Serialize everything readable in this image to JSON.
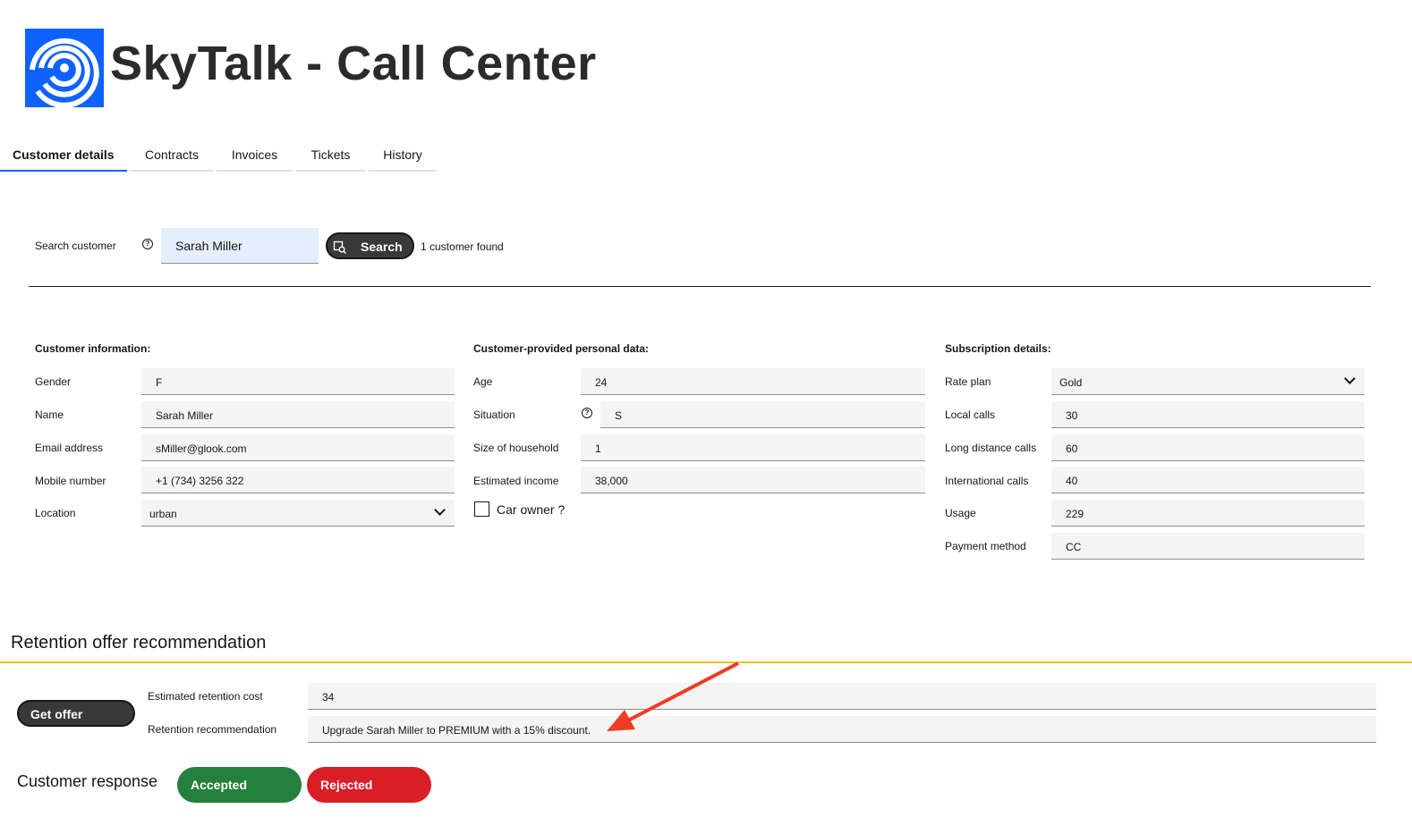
{
  "app": {
    "title": "SkyTalk - Call Center",
    "logo_icon": "spiral-logo-icon",
    "brand_color": "#0f62fe"
  },
  "tabs": [
    {
      "label": "Customer details",
      "active": true
    },
    {
      "label": "Contracts",
      "active": false
    },
    {
      "label": "Invoices",
      "active": false
    },
    {
      "label": "Tickets",
      "active": false
    },
    {
      "label": "History",
      "active": false
    }
  ],
  "search": {
    "label": "Search customer",
    "help_icon": "help-icon",
    "value": "Sarah Miller",
    "button_label": "Search",
    "button_icon": "search-icon",
    "result_text": "1 customer found"
  },
  "customer_info": {
    "heading": "Customer information:",
    "fields": [
      {
        "label": "Gender",
        "value": "F"
      },
      {
        "label": "Name",
        "value": "Sarah Miller"
      },
      {
        "label": "Email address",
        "value": "sMiller@glook.com"
      },
      {
        "label": "Mobile number",
        "value": "+1 (734) 3256 322"
      },
      {
        "label": "Location",
        "value": "urban"
      }
    ]
  },
  "personal_data": {
    "heading": "Customer-provided personal data:",
    "fields": [
      {
        "label": "Age",
        "value": "24"
      },
      {
        "label": "Situation",
        "value": "S"
      },
      {
        "label": "Size of household",
        "value": "1"
      },
      {
        "label": "Estimated income",
        "value": "38,000"
      }
    ],
    "car_owner_label": "Car owner ?",
    "car_owner_checked": false
  },
  "subscription": {
    "heading": "Subscription details:",
    "fields": [
      {
        "label": "Rate plan",
        "value": "Gold"
      },
      {
        "label": "Local calls",
        "value": "30"
      },
      {
        "label": "Long distance calls",
        "value": "60"
      },
      {
        "label": "International calls",
        "value": "40"
      },
      {
        "label": "Usage",
        "value": "229"
      },
      {
        "label": "Payment method",
        "value": "CC"
      }
    ]
  },
  "retention": {
    "title": "Retention offer recommendation",
    "accent_color": "#f1c21b",
    "get_offer_label": "Get offer",
    "cost_label": "Estimated retention cost",
    "cost_value": "34",
    "recommendation_label": "Retention recommendation",
    "recommendation_value": "Upgrade Sarah Miller to PREMIUM with a 15% discount."
  },
  "response": {
    "label": "Customer response",
    "accepted_label": "Accepted",
    "accepted_color": "#24803c",
    "rejected_label": "Rejected",
    "rejected_color": "#da1e28"
  },
  "annotation": {
    "arrow_color": "#f03c22"
  }
}
